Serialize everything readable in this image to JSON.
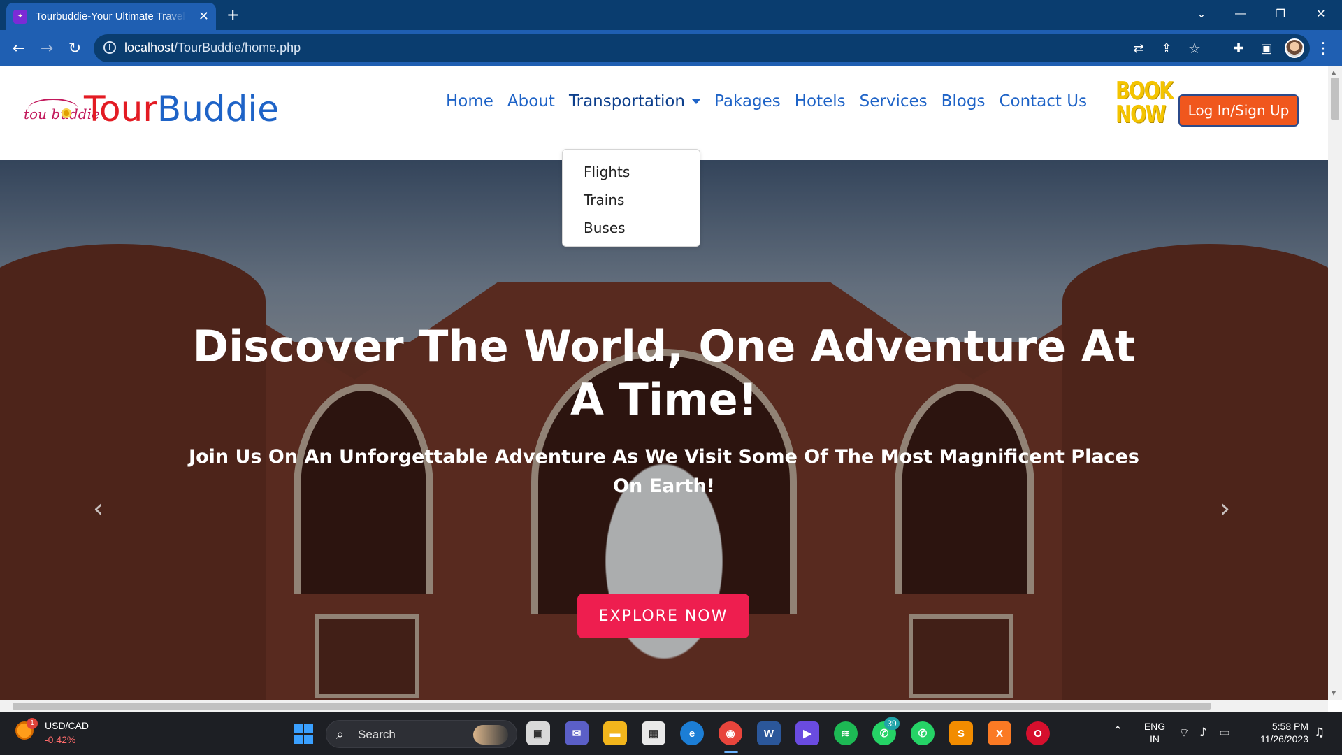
{
  "browser": {
    "tab_title": "Tourbuddie-Your Ultimate Travel Buddie",
    "tab_close": "✕",
    "new_tab": "+",
    "url_host": "localhost",
    "url_path": "/TourBuddie/home.php",
    "window_controls": [
      "⌄",
      "—",
      "❐",
      "✕"
    ],
    "nav": {
      "back": "←",
      "forward": "→",
      "reload": "↻"
    }
  },
  "site": {
    "logo_script": "tou buddie",
    "brand_part1": "Tour",
    "brand_part2": "Buddie",
    "nav": [
      {
        "label": "Home"
      },
      {
        "label": "About"
      },
      {
        "label": "Transportation"
      },
      {
        "label": "Pakages"
      },
      {
        "label": "Hotels"
      },
      {
        "label": "Services"
      },
      {
        "label": "Blogs"
      },
      {
        "label": "Contact Us"
      }
    ],
    "book_now_line1": "BOOK",
    "book_now_line2": "NOW",
    "login_label": "Log In/Sign Up",
    "dropdown": [
      "Flights",
      "Trains",
      "Buses"
    ]
  },
  "hero": {
    "title": "Discover The World, One Adventure At A Time!",
    "subtitle": "Join Us On An Unforgettable Adventure As We Visit Some Of The Most Magnificent Places On Earth!",
    "cta": "EXPLORE NOW",
    "prev": "‹",
    "next": "›"
  },
  "taskbar": {
    "weather_badge": "1",
    "stock_name": "USD/CAD",
    "stock_change": "-0.42%",
    "search_label": "Search",
    "whatsapp_badge": "39",
    "lang_line1": "ENG",
    "lang_line2": "IN",
    "time": "5:58 PM",
    "date": "11/26/2023"
  },
  "colors": {
    "brand_red": "#e31b23",
    "brand_blue": "#1e63c7",
    "login_orange": "#f0571d",
    "cta_pink": "#ee1e4f",
    "book_yellow": "#f4c400",
    "chrome_blue": "#1f5fb2"
  }
}
